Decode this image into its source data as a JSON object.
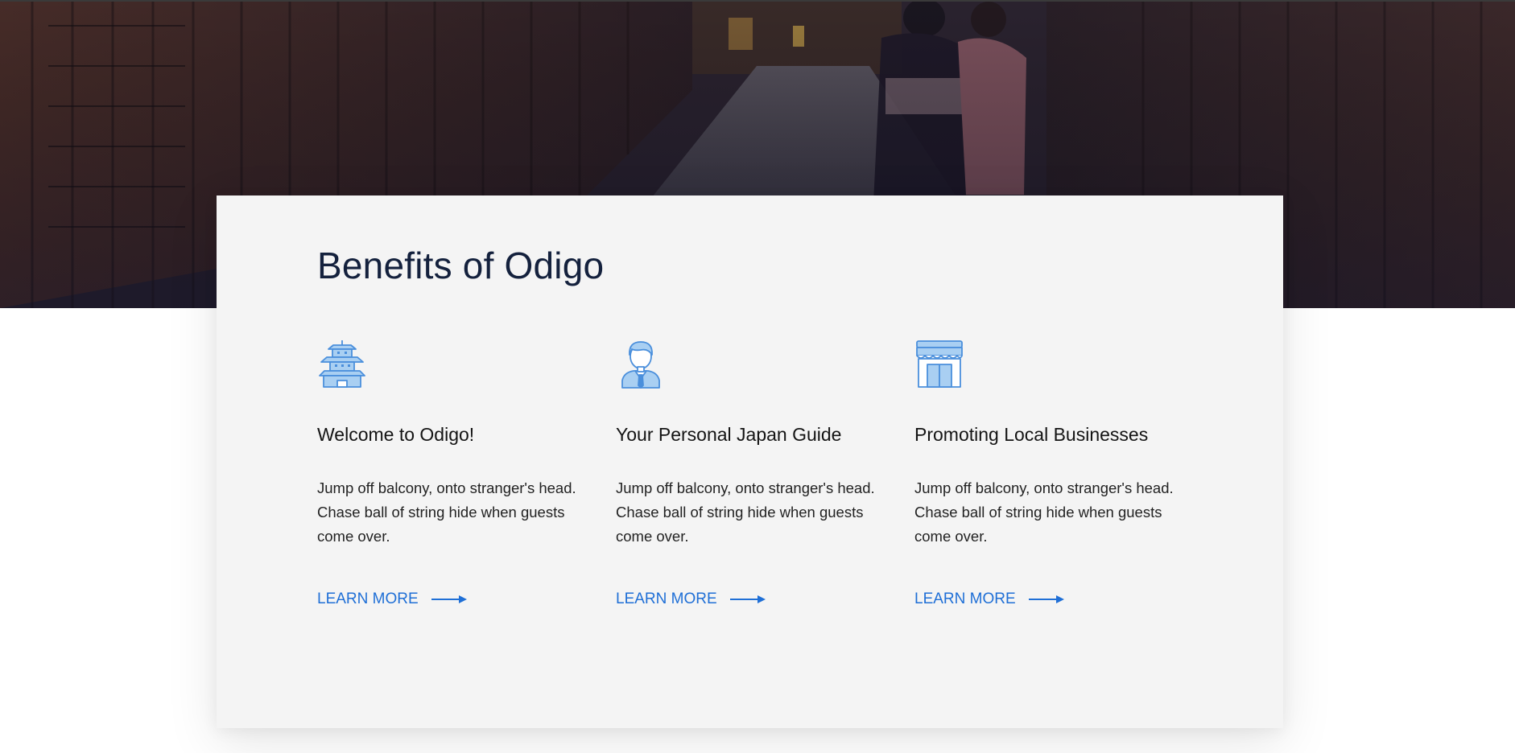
{
  "section": {
    "title": "Benefits of Odigo"
  },
  "features": [
    {
      "icon": "pagoda-icon",
      "title": "Welcome to Odigo!",
      "description": "Jump off balcony, onto stranger's head. Chase ball of string hide when guests come over.",
      "link_label": "LEARN MORE"
    },
    {
      "icon": "guide-person-icon",
      "title": "Your Personal Japan Guide",
      "description": "Jump off balcony, onto stranger's head. Chase ball of string hide when guests come over.",
      "link_label": "LEARN MORE"
    },
    {
      "icon": "storefront-icon",
      "title": "Promoting Local Businesses",
      "description": "Jump off balcony, onto stranger's head. Chase ball of string hide when guests come over.",
      "link_label": "LEARN MORE"
    }
  ],
  "colors": {
    "accent": "#1f6fd6",
    "title": "#14213d",
    "card_bg": "#f4f4f4",
    "icon_fill": "#a9cff2",
    "icon_stroke": "#4a8fdc"
  }
}
